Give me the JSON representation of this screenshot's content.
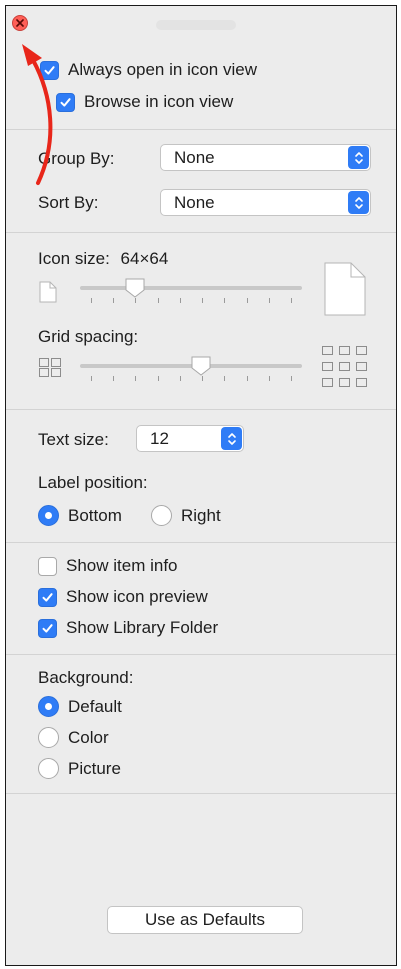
{
  "window": {
    "accent_color": "#2f7cf6",
    "close_color": "#ff5f57"
  },
  "view_options": {
    "always_open_icon_view": {
      "label": "Always open in icon view",
      "checked": true
    },
    "browse_icon_view": {
      "label": "Browse in icon view",
      "checked": true
    }
  },
  "arrange": {
    "group_by": {
      "label": "Group By:",
      "value": "None"
    },
    "sort_by": {
      "label": "Sort By:",
      "value": "None"
    }
  },
  "icon_size": {
    "label": "Icon size:",
    "value": "64×64",
    "slider_level": 0.22
  },
  "grid_spacing": {
    "label": "Grid spacing:",
    "slider_level": 0.55
  },
  "text": {
    "size_label": "Text size:",
    "size_value": "12",
    "label_position_label": "Label position:",
    "options": [
      {
        "label": "Bottom",
        "selected": true
      },
      {
        "label": "Right",
        "selected": false
      }
    ]
  },
  "show": [
    {
      "label": "Show item info",
      "checked": false
    },
    {
      "label": "Show icon preview",
      "checked": true
    },
    {
      "label": "Show Library Folder",
      "checked": true
    }
  ],
  "background": {
    "label": "Background:",
    "options": [
      {
        "label": "Default",
        "selected": true
      },
      {
        "label": "Color",
        "selected": false
      },
      {
        "label": "Picture",
        "selected": false
      }
    ]
  },
  "defaults_button": {
    "label": "Use as Defaults"
  },
  "annotation": {
    "arrow_color": "#e8261a"
  }
}
